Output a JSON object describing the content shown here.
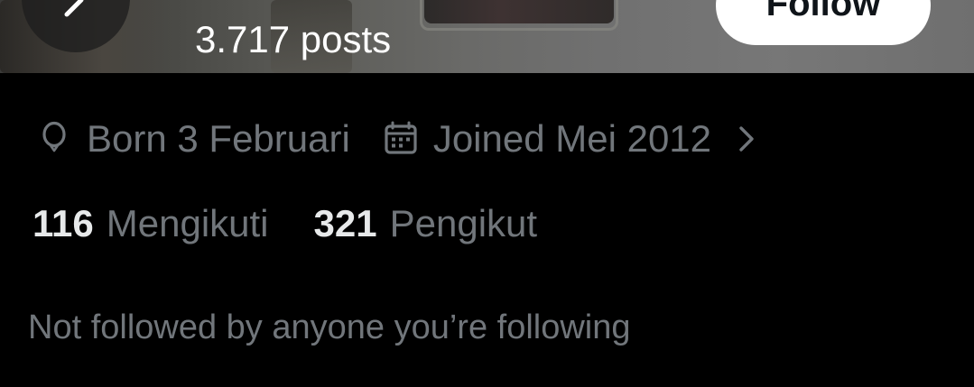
{
  "header": {
    "posts_count": "3.717 posts",
    "follow_label": "Follow"
  },
  "profile_meta": {
    "birthday": "Born 3 Februari",
    "joined": "Joined Mei 2012"
  },
  "stats": {
    "following_count": "116",
    "following_label": "Mengikuti",
    "followers_count": "321",
    "followers_label": "Pengikut"
  },
  "mutuals_text": "Not followed by anyone you’re following",
  "icons": {
    "back": "arrow-left-icon",
    "birthday": "balloon-icon",
    "joined": "calendar-icon",
    "more": "chevron-right-icon"
  },
  "colors": {
    "background": "#000000",
    "primary_text": "#e7e9ea",
    "secondary_text": "#71767b",
    "follow_button_bg": "#ffffff"
  }
}
